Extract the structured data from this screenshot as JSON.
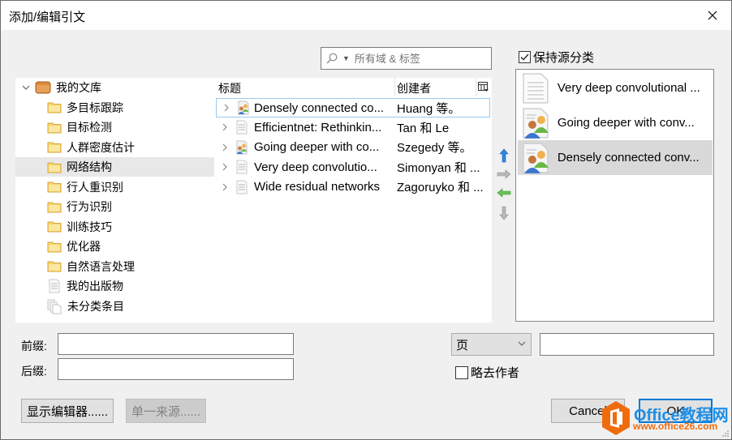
{
  "window": {
    "title": "添加/编辑引文",
    "close_icon": "close-icon"
  },
  "search": {
    "placeholder": "所有域 & 标签",
    "value": "",
    "icon": "search-icon"
  },
  "library": {
    "root_label": "我的文库",
    "items": [
      {
        "label": "多目标跟踪",
        "icon": "folder-icon",
        "selected": false
      },
      {
        "label": "目标检测",
        "icon": "folder-icon",
        "selected": false
      },
      {
        "label": "人群密度估计",
        "icon": "folder-icon",
        "selected": false
      },
      {
        "label": "网络结构",
        "icon": "folder-icon",
        "selected": true
      },
      {
        "label": "行人重识别",
        "icon": "folder-icon",
        "selected": false
      },
      {
        "label": "行为识别",
        "icon": "folder-icon",
        "selected": false
      },
      {
        "label": "训练技巧",
        "icon": "folder-icon",
        "selected": false
      },
      {
        "label": "优化器",
        "icon": "folder-icon",
        "selected": false
      },
      {
        "label": "自然语言处理",
        "icon": "folder-icon",
        "selected": false
      },
      {
        "label": "我的出版物",
        "icon": "document-icon",
        "selected": false
      },
      {
        "label": "未分类条目",
        "icon": "unfiled-icon",
        "selected": false
      }
    ]
  },
  "items_table": {
    "columns": {
      "title": "标题",
      "creator": "创建者"
    },
    "rows": [
      {
        "title": "Densely connected co...",
        "creator": "Huang 等。",
        "icon": "conference-paper-icon",
        "focused": true
      },
      {
        "title": "Efficientnet: Rethinkin...",
        "creator": "Tan 和 Le",
        "icon": "document-icon",
        "focused": false
      },
      {
        "title": "Going deeper with co...",
        "creator": "Szegedy 等。",
        "icon": "conference-paper-icon",
        "focused": false
      },
      {
        "title": "Very deep convolutio...",
        "creator": "Simonyan 和 ...",
        "icon": "document-icon",
        "focused": false
      },
      {
        "title": "Wide residual networks",
        "creator": "Zagoruyko 和 ...",
        "icon": "document-icon",
        "focused": false
      }
    ]
  },
  "move_buttons": [
    "arrow-up-icon",
    "arrow-right-icon",
    "arrow-left-icon",
    "arrow-down-icon"
  ],
  "keep_source": {
    "label": "保持源分类",
    "checked": true
  },
  "selected_citations": [
    {
      "title": "Very deep convolutional ...",
      "icon": "document-icon",
      "selected": false
    },
    {
      "title": "Going deeper with conv...",
      "icon": "conference-paper-icon",
      "selected": false
    },
    {
      "title": "Densely connected conv...",
      "icon": "conference-paper-icon",
      "selected": true
    }
  ],
  "form": {
    "prefix_label": "前缀:",
    "prefix_value": "",
    "suffix_label": "后缀:",
    "suffix_value": "",
    "locator_selected": "页",
    "locator_value": "",
    "omit_author_label": "略去作者",
    "omit_author_checked": false
  },
  "buttons": {
    "show_editor": "显示编辑器......",
    "single_source": "单一来源......",
    "cancel": "Cancel",
    "ok": "OK"
  },
  "watermark": {
    "title": "Office教程网",
    "url": "www.office26.com"
  },
  "colors": {
    "accent": "#0078d7",
    "selection": "#d9d9d9",
    "folder": "#f5c54a",
    "watermark_blue": "#1e8ee6",
    "watermark_orange": "#ef6c0d"
  }
}
